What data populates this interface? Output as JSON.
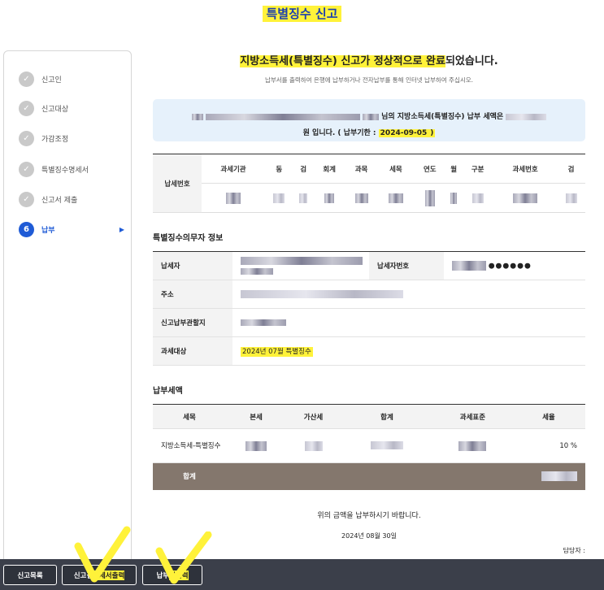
{
  "page": {
    "title": "특별징수 신고"
  },
  "sidebar": {
    "steps": [
      {
        "num": "",
        "label": "신고인",
        "state": "done"
      },
      {
        "num": "",
        "label": "신고대상",
        "state": "done"
      },
      {
        "num": "",
        "label": "가감조정",
        "state": "done"
      },
      {
        "num": "",
        "label": "특별징수명세서",
        "state": "done"
      },
      {
        "num": "",
        "label": "신고서 제출",
        "state": "done"
      },
      {
        "num": "6",
        "label": "납부",
        "state": "active"
      }
    ],
    "active_arrow": "▶"
  },
  "main": {
    "done_title_highlighted": "지방소득세(특별징수) 신고가 정상적으로 완료",
    "done_title_rest": "되었습니다.",
    "done_subtitle": "납부서를 출력하여 은행에 납부하거나 전자납부를 통해 인터넷 납부하여 주십시오.",
    "notice_line1": "님의 지방소득세(특별징수) 납부 세액은",
    "notice_line2_prefix": "원 입니다. ( 납부기한 :",
    "notice_deadline": "2024-09-05",
    "notice_line2_suffix": ")"
  },
  "tax_number_table": {
    "row_header": "납세번호",
    "columns": [
      "과세기관",
      "동",
      "검",
      "회계",
      "과목",
      "세목",
      "연도",
      "월",
      "구분",
      "과세번호",
      "검"
    ]
  },
  "taxpayer_info": {
    "section_title": "특별징수의무자 정보",
    "labels": {
      "taxpayer": "납세자",
      "taxpayer_number": "납세자번호",
      "address": "주소",
      "office": "신고납부관할지",
      "target": "과세대상"
    },
    "taxpayer_number_masked": "●●●●●●",
    "target_value": "2024년 07월 특별징수"
  },
  "amount": {
    "section_title": "납부세액",
    "columns": [
      "세목",
      "본세",
      "가산세",
      "합계",
      "과세표준",
      "세율"
    ],
    "row": {
      "tax_item": "지방소득세-특별징수",
      "rate": "10 %"
    },
    "total_label": "합계",
    "closing_text": "위의 금액을 납부하시기 바랍니다.",
    "date": "2024년 08월 30일",
    "manager_label": "담당자 :"
  },
  "bottom_bar": {
    "buttons": [
      {
        "label_a": "신고목록",
        "label_hl": "",
        "label_b": ""
      },
      {
        "label_a": "신고결",
        "label_hl": "과세서출력",
        "label_b": ""
      },
      {
        "label_a": "납부",
        "label_hl": "서출력",
        "label_b": ""
      }
    ]
  },
  "colors": {
    "accent_blue": "#1f5bd6",
    "highlight_yellow": "#fff23a",
    "total_row": "#84776d",
    "bottom_bar": "#3b3f4a",
    "notice_bg": "#e6f1fb"
  }
}
